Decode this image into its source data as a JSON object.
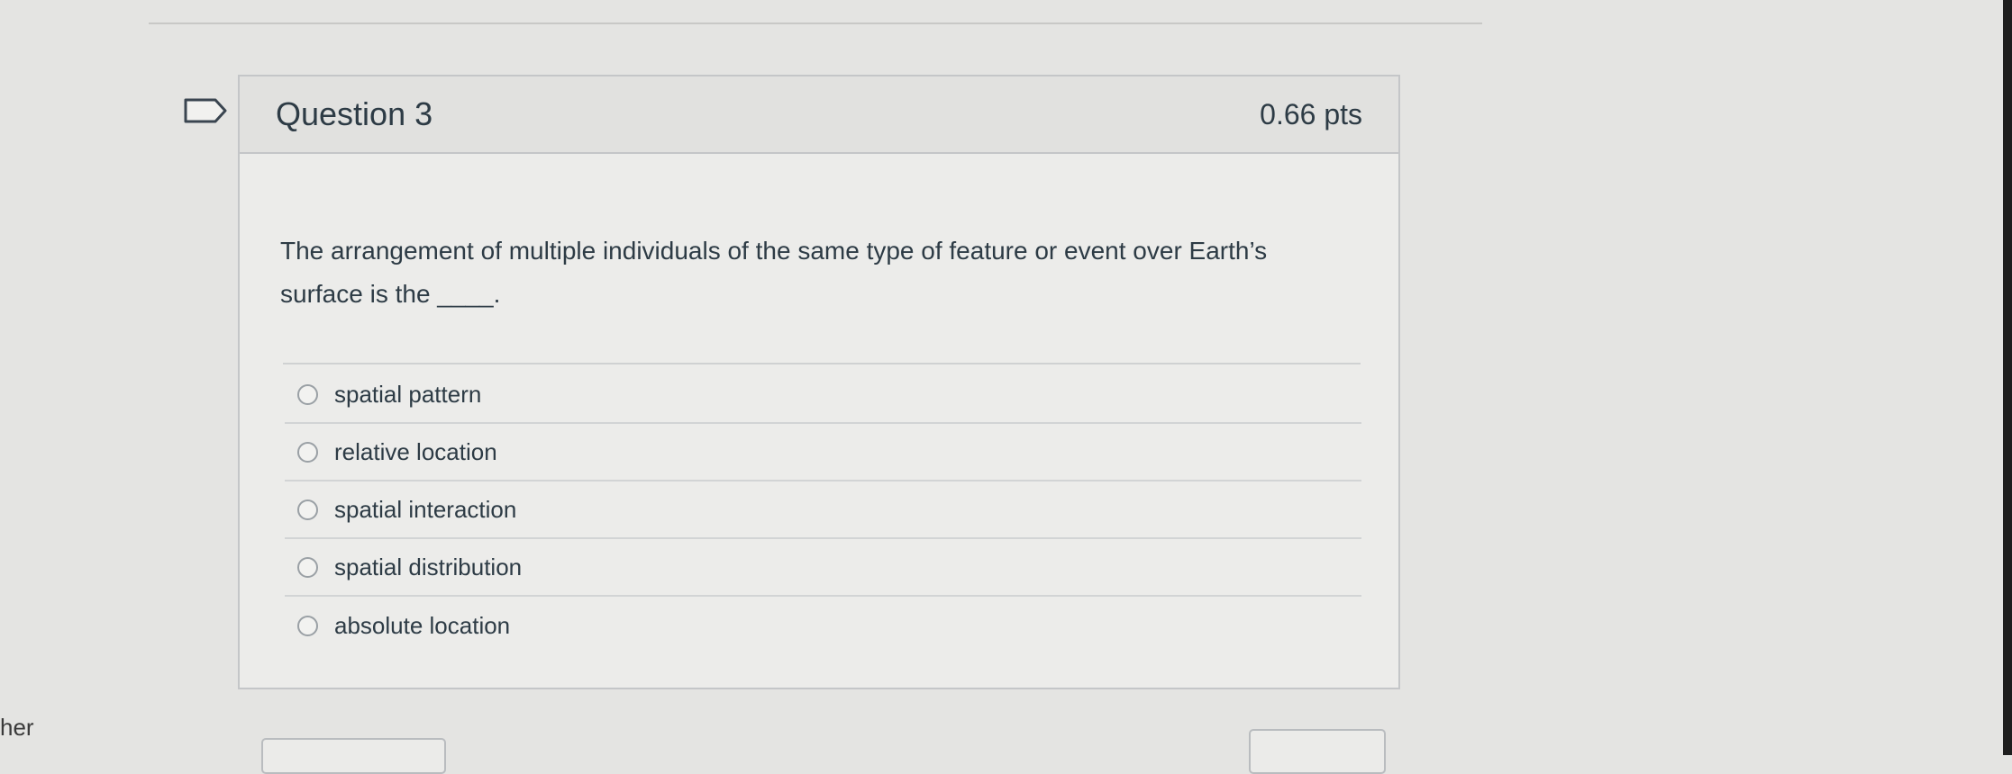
{
  "question": {
    "title": "Question 3",
    "points": "0.66 pts",
    "text": "The arrangement of multiple individuals of the same type of feature or event over Earth’s surface is the ____.",
    "answers": [
      {
        "label": "spatial pattern",
        "selected": false
      },
      {
        "label": "relative location",
        "selected": false
      },
      {
        "label": "spatial interaction",
        "selected": false
      },
      {
        "label": "spatial distribution",
        "selected": false
      },
      {
        "label": "absolute location",
        "selected": false
      }
    ]
  },
  "side_text": "her",
  "icons": {
    "flag": "flag-icon",
    "radio": "radio-icon"
  },
  "colors": {
    "text": "#2d3b45",
    "background": "#e4e4e2",
    "border": "#c4c6c8"
  }
}
